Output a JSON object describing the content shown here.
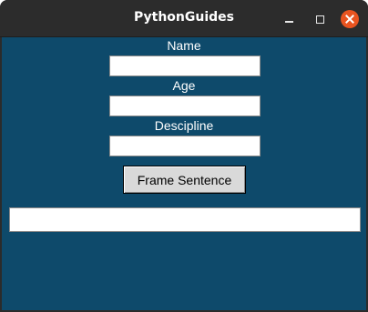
{
  "window": {
    "title": "PythonGuides",
    "controls": {
      "minimize_icon": "minimize-icon",
      "maximize_icon": "maximize-icon",
      "close_icon": "close-icon",
      "close_color": "#e95420"
    }
  },
  "form": {
    "background": "#0e4a6b",
    "name_label": "Name",
    "name_value": "",
    "age_label": "Age",
    "age_value": "",
    "discipline_label": "Descipline",
    "discipline_value": "",
    "button_label": "Frame Sentence",
    "output_value": ""
  }
}
